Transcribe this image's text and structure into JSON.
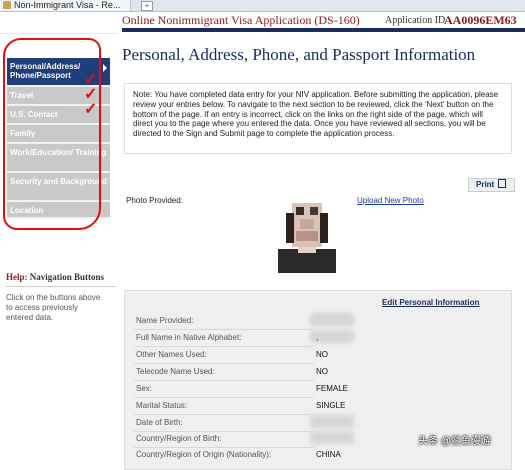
{
  "browser": {
    "tab_title": "Non-Immigrant Visa - Re...",
    "new_tab_glyph": "+"
  },
  "header": {
    "title": "Online Nonimmigrant Visa Application (DS-160)",
    "appid_label": "Application ID",
    "appid": "AA0096EM63"
  },
  "nav": {
    "items": [
      {
        "label": "Personal/Address/ Phone/Passport",
        "active": true
      },
      {
        "label": "Travel"
      },
      {
        "label": "U.S. Contact"
      },
      {
        "label": "Family"
      },
      {
        "label": "Work/Education/ Training"
      },
      {
        "label": "Security and Background"
      },
      {
        "label": "Location"
      }
    ]
  },
  "annotation": {
    "checks": "v\nv\nv"
  },
  "help": {
    "title_prefix": "Help:",
    "title_rest": "Navigation Buttons",
    "text": "Click on the buttons above to access previously entered data."
  },
  "main": {
    "page_title": "Personal, Address, Phone, and Passport Information",
    "note": "Note: You have completed data entry for your NIV application. Before submitting the application, please review your entries below. To navigate to the next section to be reviewed, click the 'Next' button on the bottom of the page. If an entry is incorrect, click on the links on the right side of the page, which will direct you to the page where you entered the data. Once you have reviewed all sections, you will be directed to the Sign and Submit page to complete the application process.",
    "print_label": "Print",
    "photo_label": "Photo Provided:",
    "upload_link": "Upload New Photo",
    "edit_link": "Edit Personal Information",
    "rows": [
      {
        "label": "Name Provided:",
        "value": ""
      },
      {
        "label": "Full Name in Native Alphabet:",
        "value": ","
      },
      {
        "label": "Other Names Used:",
        "value": "NO"
      },
      {
        "label": "Telecode Name Used:",
        "value": "NO"
      },
      {
        "label": "Sex:",
        "value": "FEMALE"
      },
      {
        "label": "Marital Status:",
        "value": "SINGLE"
      },
      {
        "label": "Date of Birth:",
        "value": ""
      },
      {
        "label": "Country/Region of Birth:",
        "value": ""
      },
      {
        "label": "Country/Region of Origin (Nationality):",
        "value": "CHINA"
      }
    ]
  },
  "watermark": "头条 @鲨鱼漫游",
  "colors": {
    "nav_active": "#1f3e7a",
    "nav_inactive": "#c9c9c9",
    "header_red": "#8b1a1a",
    "navy": "#1a2b5c",
    "annotation_red": "#e01010"
  }
}
